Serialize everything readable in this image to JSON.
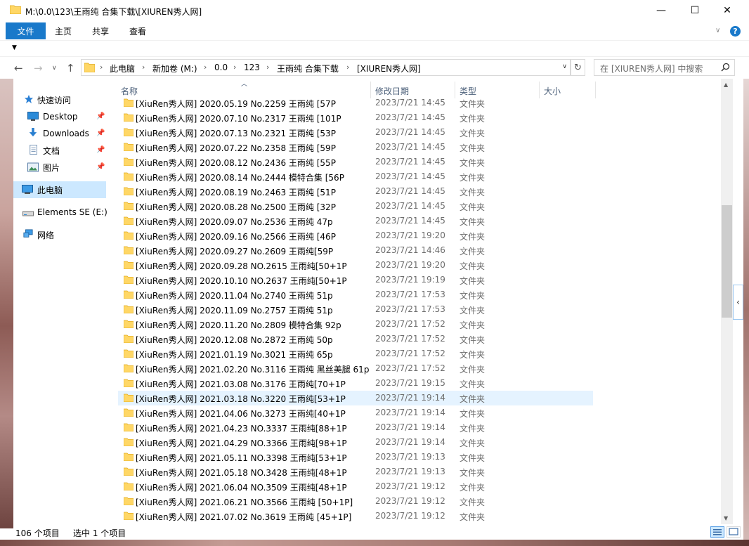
{
  "window": {
    "title": "M:\\0.0\\123\\王雨纯 合集下载\\[XIUREN秀人网]",
    "minimize_glyph": "—",
    "maximize_glyph": "☐",
    "close_glyph": "✕"
  },
  "ribbon": {
    "file_tab": "文件",
    "tabs": [
      "主页",
      "共享",
      "查看"
    ],
    "help_glyph": "?"
  },
  "nav": {
    "back_glyph": "←",
    "forward_glyph": "→",
    "recent_glyph": "∨",
    "up_glyph": "↑",
    "breadcrumbs": [
      "此电脑",
      "新加卷 (M:)",
      "0.0",
      "123",
      "王雨纯 合集下载",
      "[XIUREN秀人网]"
    ],
    "refresh_glyph": "↻",
    "search_placeholder": "在 [XIUREN秀人网] 中搜索"
  },
  "sidebar": {
    "items": [
      {
        "label": "快速访问",
        "icon": "star-icon",
        "pinned": false
      },
      {
        "label": "Desktop",
        "icon": "desktop-icon",
        "pinned": true
      },
      {
        "label": "Downloads",
        "icon": "download-icon",
        "pinned": true
      },
      {
        "label": "文档",
        "icon": "document-icon",
        "pinned": true
      },
      {
        "label": "图片",
        "icon": "picture-icon",
        "pinned": true
      },
      {
        "label": "此电脑",
        "icon": "computer-icon",
        "pinned": false,
        "selected": true
      },
      {
        "label": "Elements SE (E:)",
        "icon": "drive-icon",
        "pinned": false
      },
      {
        "label": "网络",
        "icon": "network-icon",
        "pinned": false
      }
    ]
  },
  "columns": {
    "name": "名称",
    "date": "修改日期",
    "type": "类型",
    "size": "大小"
  },
  "files": [
    {
      "name": "[XiuRen秀人网] 2020.05.19 No.2259 王雨纯 [57P",
      "date": "2023/7/21 14:45",
      "type": "文件夹"
    },
    {
      "name": "[XiuRen秀人网] 2020.07.10 No.2317 王雨纯 [101P",
      "date": "2023/7/21 14:45",
      "type": "文件夹"
    },
    {
      "name": "[XiuRen秀人网] 2020.07.13 No.2321 王雨纯 [53P",
      "date": "2023/7/21 14:45",
      "type": "文件夹"
    },
    {
      "name": "[XiuRen秀人网] 2020.07.22 No.2358 王雨纯 [59P",
      "date": "2023/7/21 14:45",
      "type": "文件夹"
    },
    {
      "name": "[XiuRen秀人网] 2020.08.12 No.2436 王雨纯 [55P",
      "date": "2023/7/21 14:45",
      "type": "文件夹"
    },
    {
      "name": "[XiuRen秀人网] 2020.08.14 No.2444 模特合集 [56P",
      "date": "2023/7/21 14:45",
      "type": "文件夹"
    },
    {
      "name": "[XiuRen秀人网] 2020.08.19 No.2463 王雨纯 [51P",
      "date": "2023/7/21 14:45",
      "type": "文件夹"
    },
    {
      "name": "[XiuRen秀人网] 2020.08.28 No.2500 王雨纯 [32P",
      "date": "2023/7/21 14:45",
      "type": "文件夹"
    },
    {
      "name": "[XiuRen秀人网] 2020.09.07 No.2536 王雨纯 47p",
      "date": "2023/7/21 14:45",
      "type": "文件夹"
    },
    {
      "name": "[XiuRen秀人网] 2020.09.16 No.2566 王雨纯 [46P",
      "date": "2023/7/21 19:20",
      "type": "文件夹"
    },
    {
      "name": "[XiuRen秀人网] 2020.09.27 No.2609 王雨纯[59P",
      "date": "2023/7/21 14:46",
      "type": "文件夹"
    },
    {
      "name": "[XiuRen秀人网] 2020.09.28 NO.2615 王雨纯[50+1P",
      "date": "2023/7/21 19:20",
      "type": "文件夹"
    },
    {
      "name": "[XiuRen秀人网] 2020.10.10 NO.2637 王雨纯[50+1P",
      "date": "2023/7/21 19:19",
      "type": "文件夹"
    },
    {
      "name": "[XiuRen秀人网] 2020.11.04 No.2740 王雨纯 51p",
      "date": "2023/7/21 17:53",
      "type": "文件夹"
    },
    {
      "name": "[XiuRen秀人网] 2020.11.09 No.2757 王雨纯 51p",
      "date": "2023/7/21 17:53",
      "type": "文件夹"
    },
    {
      "name": "[XiuRen秀人网] 2020.11.20 No.2809 模特合集 92p",
      "date": "2023/7/21 17:52",
      "type": "文件夹"
    },
    {
      "name": "[XiuRen秀人网] 2020.12.08 No.2872 王雨纯 50p",
      "date": "2023/7/21 17:52",
      "type": "文件夹"
    },
    {
      "name": "[XiuRen秀人网] 2021.01.19 No.3021 王雨纯 65p",
      "date": "2023/7/21 17:52",
      "type": "文件夹"
    },
    {
      "name": "[XiuRen秀人网] 2021.02.20 No.3116 王雨纯 黑丝美腿 61p",
      "date": "2023/7/21 17:52",
      "type": "文件夹"
    },
    {
      "name": "[XiuRen秀人网] 2021.03.08 No.3176 王雨纯[70+1P",
      "date": "2023/7/21 19:15",
      "type": "文件夹"
    },
    {
      "name": "[XiuRen秀人网] 2021.03.18 No.3220 王雨纯[53+1P",
      "date": "2023/7/21 19:14",
      "type": "文件夹",
      "selected": true
    },
    {
      "name": "[XiuRen秀人网] 2021.04.06 No.3273 王雨纯[40+1P",
      "date": "2023/7/21 19:14",
      "type": "文件夹"
    },
    {
      "name": "[XiuRen秀人网] 2021.04.23 NO.3337 王雨纯[88+1P",
      "date": "2023/7/21 19:14",
      "type": "文件夹"
    },
    {
      "name": "[XiuRen秀人网] 2021.04.29 NO.3366 王雨纯[98+1P",
      "date": "2023/7/21 19:14",
      "type": "文件夹"
    },
    {
      "name": "[XiuRen秀人网] 2021.05.11 NO.3398 王雨纯[53+1P",
      "date": "2023/7/21 19:13",
      "type": "文件夹"
    },
    {
      "name": "[XiuRen秀人网] 2021.05.18 NO.3428 王雨纯[48+1P",
      "date": "2023/7/21 19:13",
      "type": "文件夹"
    },
    {
      "name": "[XiuRen秀人网] 2021.06.04 NO.3509 王雨纯[48+1P",
      "date": "2023/7/21 19:12",
      "type": "文件夹"
    },
    {
      "name": "[XiuRen秀人网] 2021.06.21 NO.3566 王雨纯 [50+1P]",
      "date": "2023/7/21 19:12",
      "type": "文件夹"
    },
    {
      "name": "[XiuRen秀人网] 2021.07.02 No.3619 王雨纯 [45+1P]",
      "date": "2023/7/21 19:12",
      "type": "文件夹"
    }
  ],
  "status": {
    "item_count": "106 个项目",
    "selected_count": "选中 1 个项目"
  },
  "colors": {
    "accent": "#1979ca",
    "selection": "#cce8ff",
    "hover_row": "#e5f3ff",
    "folder": "#ffd766"
  }
}
